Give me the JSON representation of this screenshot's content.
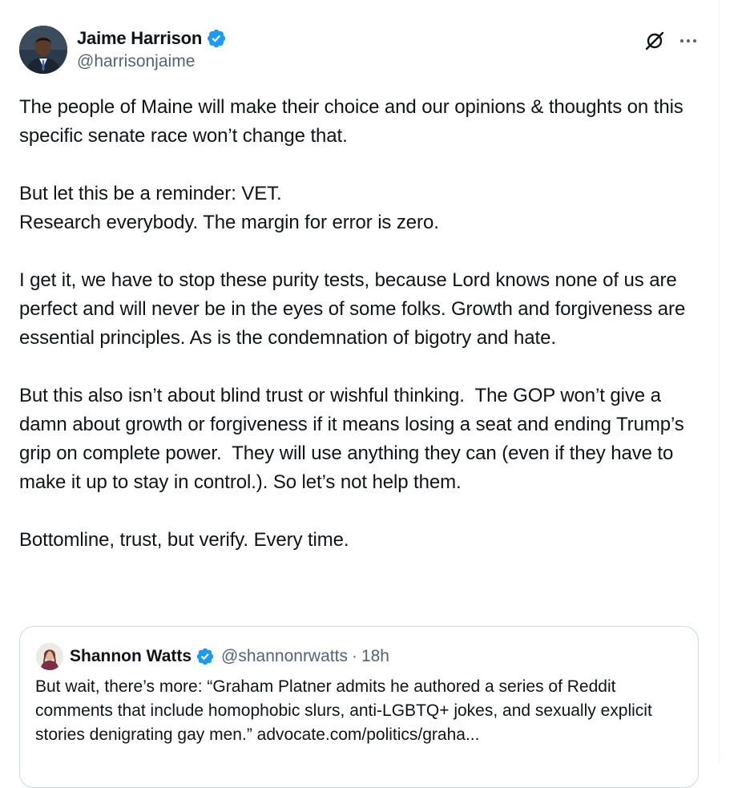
{
  "tweet": {
    "author": {
      "name": "Jaime Harrison",
      "handle": "@harrisonjaime",
      "verified": true
    },
    "paragraphs": [
      "The people of Maine will make their choice and our opinions & thoughts on this specific senate race won’t change that.",
      "But let this be a reminder: VET.\nResearch everybody. The margin for error is zero.",
      "I get it, we have to stop these purity tests, because Lord knows none of us are perfect and will never be in the eyes of some folks. Growth and forgiveness are essential principles. As is the condemnation of bigotry and hate.",
      "But this also isn’t about blind trust or wishful thinking.  The GOP won’t give a damn about growth or forgiveness if it means losing a seat and ending Trump’s grip on complete power.  They will use anything they can (even if they have to make it up to stay in control.). So let’s not help them.",
      "Bottomline, trust, but verify. Every time."
    ]
  },
  "quoted_tweet": {
    "author": {
      "name": "Shannon Watts",
      "handle": "@shannonrwatts",
      "verified": true
    },
    "separator": "·",
    "time": "18h",
    "text": "But wait, there’s more: “Graham Platner admits he authored a series of Reddit comments that include homophobic slurs, anti-LGBTQ+ jokes, and sexually explicit stories denigrating gay men.” advocate.com/politics/graha..."
  },
  "icons": {
    "verified_badge": "verified-badge-icon",
    "grok": "grok-icon",
    "more": "more-options-icon"
  },
  "colors": {
    "verified_blue": "#1d9bf0",
    "text_primary": "#0f1419",
    "text_secondary": "#536471",
    "border": "#cfd9de"
  }
}
